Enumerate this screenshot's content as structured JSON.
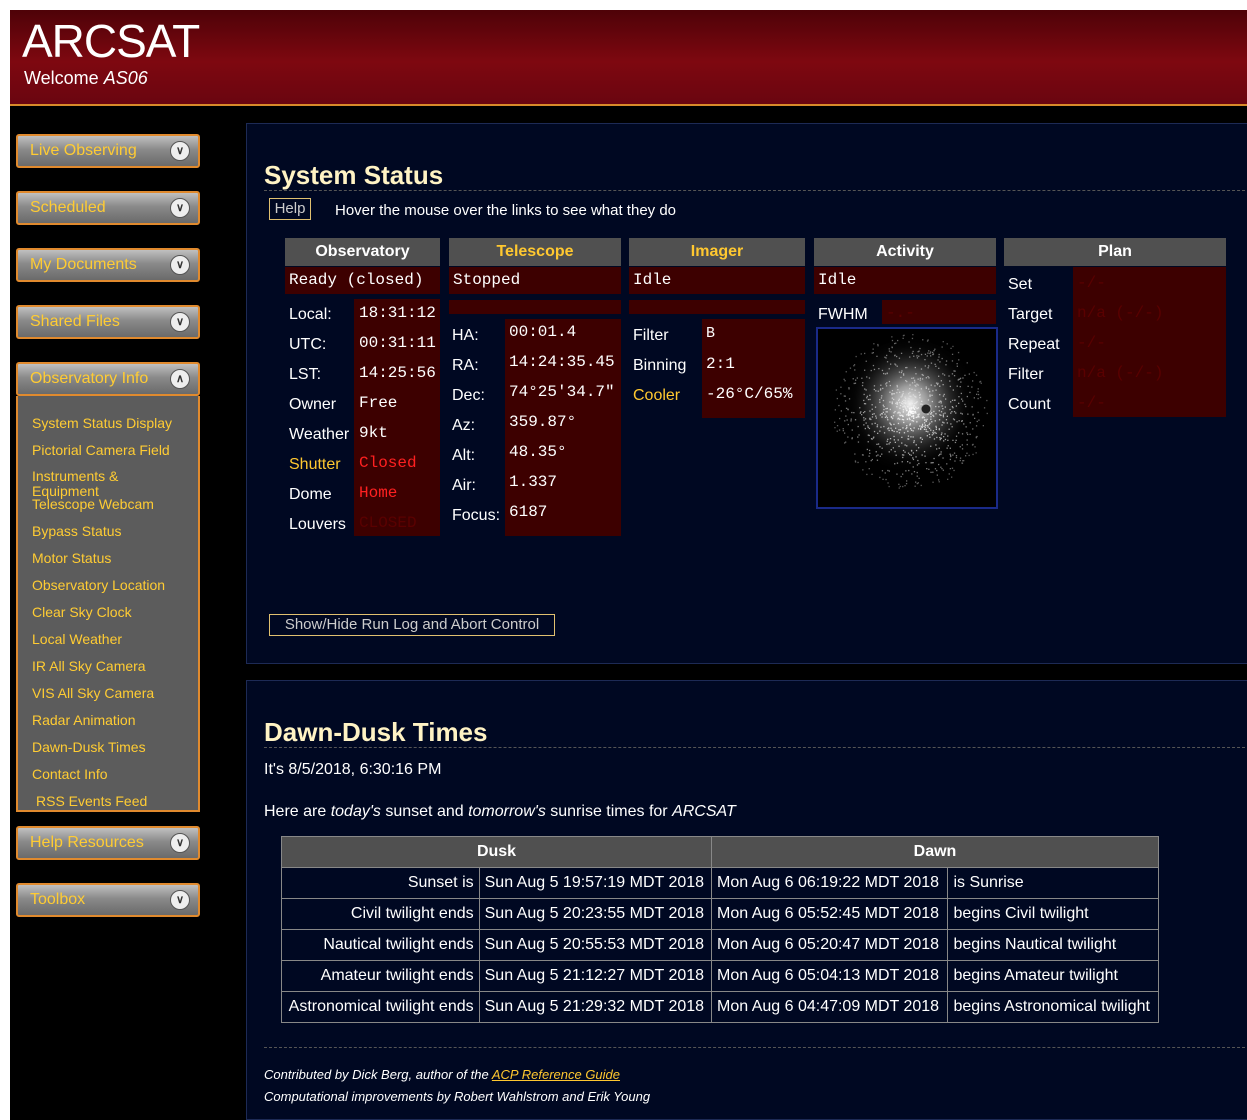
{
  "header": {
    "title": "ARCSAT",
    "welcome_prefix": "Welcome ",
    "user": "AS06"
  },
  "sidebar": {
    "menus": [
      {
        "label": "Live Observing"
      },
      {
        "label": "Scheduled"
      },
      {
        "label": "My Documents"
      },
      {
        "label": "Shared Files"
      },
      {
        "label": "Observatory Info"
      },
      {
        "label": "Help Resources"
      },
      {
        "label": "Toolbox"
      }
    ],
    "observatory_links": [
      "System Status Display",
      "Pictorial Camera Field",
      "Instruments & Equipment",
      "Telescope Webcam",
      "Bypass Status",
      "Motor Status",
      "Observatory Location",
      "Clear Sky Clock",
      "Local Weather",
      "IR All Sky Camera",
      "VIS All Sky Camera",
      "Radar Animation",
      "Dawn-Dusk Times",
      "Contact Info",
      "RSS Events Feed"
    ]
  },
  "system_status": {
    "heading": "System Status",
    "help_label": "Help",
    "hover_note": "Hover the mouse over the links to see what they do",
    "columns": {
      "observatory": "Observatory",
      "telescope": "Telescope",
      "imager": "Imager",
      "activity": "Activity",
      "plan": "Plan"
    },
    "observatory": {
      "status": "Ready (closed)",
      "local_label": "Local:",
      "local": "18:31:12",
      "utc_label": "UTC:",
      "utc": "00:31:11",
      "lst_label": "LST:",
      "lst": "14:25:56",
      "owner_label": "Owner",
      "owner": "Free",
      "weather_label": "Weather",
      "weather": "9kt",
      "shutter_label": "Shutter",
      "shutter": "Closed",
      "dome_label": "Dome",
      "dome": "Home",
      "louvers_label": "Louvers",
      "louvers": "CLOSED"
    },
    "telescope": {
      "status": "Stopped",
      "ha_label": "HA:",
      "ha": "00:01.4",
      "ra_label": "RA:",
      "ra": "14:24:35.45",
      "dec_label": "Dec:",
      "dec": "74°25'34.7\"",
      "az_label": "Az:",
      "az": "359.87°",
      "alt_label": "Alt:",
      "alt": "48.35°",
      "air_label": "Air:",
      "air": "1.337",
      "focus_label": "Focus:",
      "focus": "6187"
    },
    "imager": {
      "status": "Idle",
      "filter_label": "Filter",
      "filter": "B",
      "binning_label": "Binning",
      "binning": "2:1",
      "cooler_label": "Cooler",
      "cooler": "-26°C/65%"
    },
    "activity": {
      "status": "Idle",
      "fwhm_label": "FWHM",
      "fwhm": "-.-"
    },
    "plan": {
      "set_label": "Set",
      "set": "-/-",
      "target_label": "Target",
      "target": "n/a (-/-)",
      "repeat_label": "Repeat",
      "repeat": "-/-",
      "filter_label": "Filter",
      "filter": "n/a (-/-)",
      "count_label": "Count",
      "count": "-/-"
    },
    "runlog_label": "Show/Hide Run Log and Abort Control"
  },
  "dawn_dusk": {
    "heading": "Dawn-Dusk Times",
    "now_text": "It's 8/5/2018, 6:30:16 PM",
    "intro": {
      "p1": "Here are ",
      "today": "today's",
      "p2": " sunset and ",
      "tomorrow": "tomorrow's",
      "p3": " sunrise times for ",
      "site": "ARCSAT"
    },
    "headers": {
      "dusk": "Dusk",
      "dawn": "Dawn"
    },
    "rows": [
      [
        "Sunset is",
        "Sun Aug 5 19:57:19 MDT 2018",
        "Mon Aug 6 06:19:22 MDT 2018",
        "is Sunrise"
      ],
      [
        "Civil twilight ends",
        "Sun Aug 5 20:23:55 MDT 2018",
        "Mon Aug 6 05:52:45 MDT 2018",
        "begins Civil twilight"
      ],
      [
        "Nautical twilight ends",
        "Sun Aug 5 20:55:53 MDT 2018",
        "Mon Aug 6 05:20:47 MDT 2018",
        "begins Nautical twilight"
      ],
      [
        "Amateur twilight ends",
        "Sun Aug 5 21:12:27 MDT 2018",
        "Mon Aug 6 05:04:13 MDT 2018",
        "begins Amateur twilight"
      ],
      [
        "Astronomical twilight ends",
        "Sun Aug 5 21:29:32 MDT 2018",
        "Mon Aug 6 04:47:09 MDT 2018",
        "begins Astronomical twilight"
      ]
    ],
    "credit1_prefix": "Contributed by Dick Berg, author of the ",
    "credit1_link": "ACP Reference Guide",
    "credit2": "Computational improvements by Robert Wahlstrom and Erik Young"
  }
}
